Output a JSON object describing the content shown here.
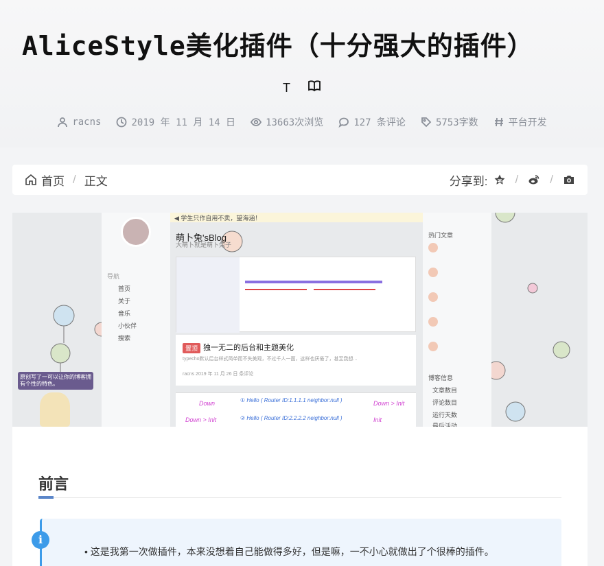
{
  "post": {
    "title": "AliceStyle美化插件（十分强大的插件）",
    "tools": [
      "T",
      "📖"
    ],
    "meta": {
      "author": "racns",
      "date": "2019 年 11 月 14 日",
      "views": "13663次浏览",
      "comments": "127 条评论",
      "words": "5753字数",
      "category": "平台开发"
    }
  },
  "breadcrumb": {
    "home": "首页",
    "current": "正文",
    "share_label": "分享到:"
  },
  "banner": {
    "notice": "◀ 学生只作自用不卖，望海涵！",
    "blog_name": "萌卜兔'sBlog",
    "blog_sub": "大萌卜就是萌卜兔子",
    "post_badge": "置顶",
    "post_title": "独一无二的后台和主题美化",
    "post_excerpt": "typecho默认后台样式简单而不失美观，不过千人一面，这样也厌倦了，甚至我想...",
    "post_meta": "racns   2019 年 11 月 26 日   条评论",
    "nav": [
      "首页",
      "关于",
      "音乐",
      "小伙伴",
      "搜索"
    ],
    "nav_section": "导航",
    "widget_title": "热门文章",
    "widget2_title": "博客信息",
    "widget2_items": [
      "文章数目",
      "评论数目",
      "运行天数",
      "最后活动"
    ],
    "mascot_text": "原创写了一可以让你的博客拥有个性的特色。",
    "route_labels": [
      "Down",
      "Down > Init",
      "① Hello ( Router ID:1.1.1.1  neighbor:null )",
      "② Hello ( Router ID:2.2.2.2  neighbor:null )",
      "Down > Init",
      "Init"
    ]
  },
  "content": {
    "heading": "前言",
    "tip_text": "这是我第一次做插件，本来没想着自己能做得多好，但是嘛，一不小心就做出了个很棒的插件。"
  },
  "colors": {
    "accent": "#3d9be9",
    "heading_bar": "#5b86c9",
    "badge": "#e05a5a"
  }
}
